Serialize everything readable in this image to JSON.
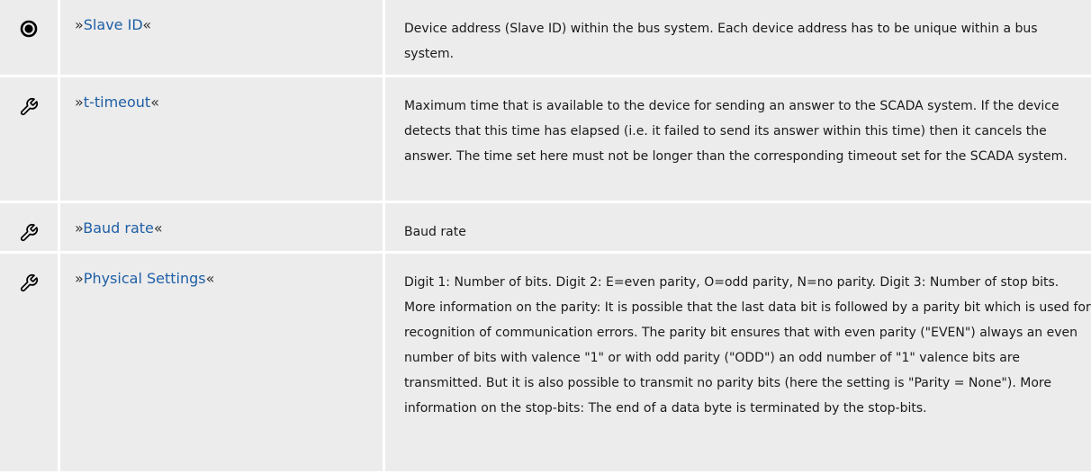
{
  "colors": {
    "row_background": "#ececec",
    "link": "#1f5fa6",
    "text": "#1a1a1a",
    "divider": "#ffffff"
  },
  "rows": [
    {
      "icon": "radio-selected-icon",
      "quote_open": "»",
      "name": "Slave ID",
      "quote_close": "«",
      "description": "Device address (Slave ID) within the bus system. Each device address has to be unique within a bus system."
    },
    {
      "icon": "wrench-icon",
      "quote_open": "»",
      "name": "t-timeout",
      "quote_close": "«",
      "description": "Maximum time that is available to the device for sending an answer to the SCADA system. If the device detects that this time has elapsed (i.e. it failed to send its answer within this time) then it cancels the answer. The time set here must not be longer than the corresponding timeout set for the SCADA system."
    },
    {
      "icon": "wrench-icon",
      "quote_open": "»",
      "name": "Baud rate",
      "quote_close": "«",
      "description": "Baud rate"
    },
    {
      "icon": "wrench-icon",
      "quote_open": "»",
      "name": "Physical Settings",
      "quote_close": "«",
      "description": "Digit 1: Number of bits. Digit 2: E=even parity, O=odd parity, N=no parity. Digit 3: Number of stop bits. More information on the parity: It is possible that the last data bit is followed by a parity bit which is used for recognition of communication errors. The parity bit ensures that with even parity (\"EVEN\") always an even number of bits with valence \"1\" or with odd parity (\"ODD\") an odd number of \"1\" valence bits are transmitted. But it is also possible to transmit no parity bits (here the setting is \"Parity = None\"). More information on the stop-bits: The end of a data byte is terminated by the stop-bits."
    }
  ]
}
